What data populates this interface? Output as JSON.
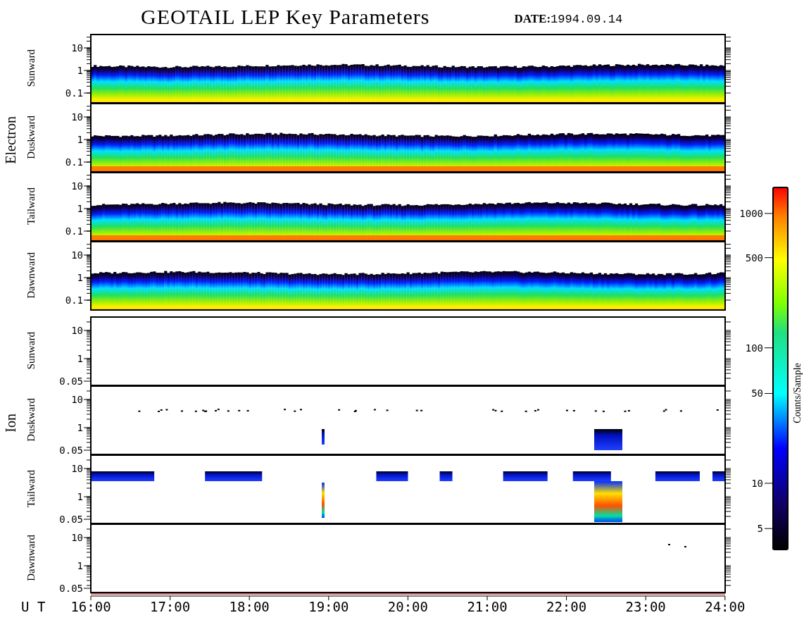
{
  "title": "GEOTAIL LEP Key Parameters",
  "date": "**DATE:**1994.09.14",
  "groups": [
    {
      "species": "Electron",
      "panels": [
        {
          "kind": "electron",
          "direction": "Sunward",
          "yticks": [
            "10",
            "1",
            "0.1"
          ]
        },
        {
          "kind": "electron",
          "direction": "Duskward",
          "yticks": [
            "10",
            "1",
            "0.1"
          ]
        },
        {
          "kind": "electron",
          "direction": "Tailward",
          "yticks": [
            "10",
            "1",
            "0.1"
          ]
        },
        {
          "kind": "electron",
          "direction": "Dawnward",
          "yticks": [
            "10",
            "1",
            "0.1"
          ]
        }
      ]
    },
    {
      "species": "Ion",
      "panels": [
        {
          "kind": "ion",
          "direction": "Sunward",
          "yticks": [
            "10",
            "1",
            "0.05"
          ]
        },
        {
          "kind": "ion",
          "direction": "Duskward",
          "yticks": [
            "10",
            "1",
            "0.05"
          ]
        },
        {
          "kind": "ion",
          "direction": "Tailward",
          "yticks": [
            "10",
            "1",
            "0.05"
          ]
        },
        {
          "kind": "ion",
          "direction": "Dawnward",
          "yticks": [
            "10",
            "1",
            "0.05"
          ]
        }
      ]
    }
  ],
  "time_axis": {
    "label": "U T",
    "ticks": [
      "16:00",
      "17:00",
      "18:00",
      "19:00",
      "20:00",
      "21:00",
      "22:00",
      "23:00",
      "24:00"
    ]
  },
  "colorbar": {
    "title": "Counts/Sample",
    "ticks": [
      "1000",
      "500",
      "100",
      "50",
      "10",
      "5"
    ]
  }
}
